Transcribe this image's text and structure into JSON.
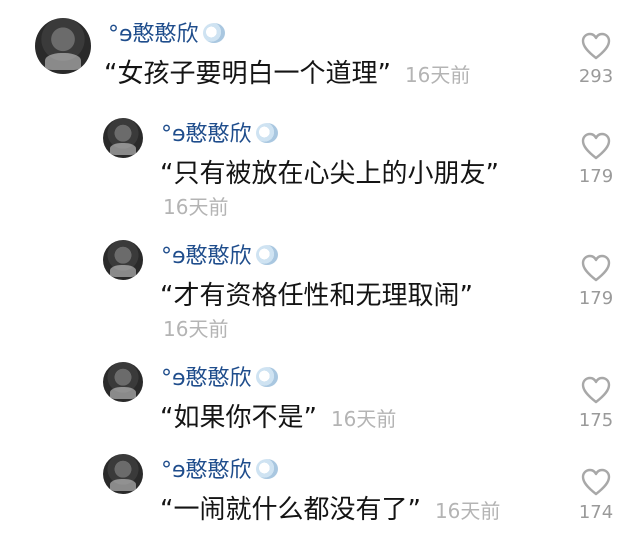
{
  "comments": [
    {
      "username": "°ɘ憨憨欣",
      "text": "“女孩子要明白一个道理”",
      "time": "16天前",
      "likes": "293"
    },
    {
      "username": "°ɘ憨憨欣",
      "text": "“只有被放在心尖上的小朋友”",
      "time": "16天前",
      "likes": "179"
    },
    {
      "username": "°ɘ憨憨欣",
      "text": "“才有资格任性和无理取闹”",
      "time": "16天前",
      "likes": "179"
    },
    {
      "username": "°ɘ憨憨欣",
      "text": "“如果你不是”",
      "time": "16天前",
      "likes": "175"
    },
    {
      "username": "°ɘ憨憨欣",
      "text": "“一闹就什么都没有了”",
      "time": "16天前",
      "likes": "174"
    }
  ],
  "icons": {
    "like": "heart-outline-icon",
    "sticker": "bubble-sticker-icon"
  },
  "colors": {
    "username": "#1f4d8c",
    "text": "#141414",
    "meta": "#b4b4b4"
  }
}
